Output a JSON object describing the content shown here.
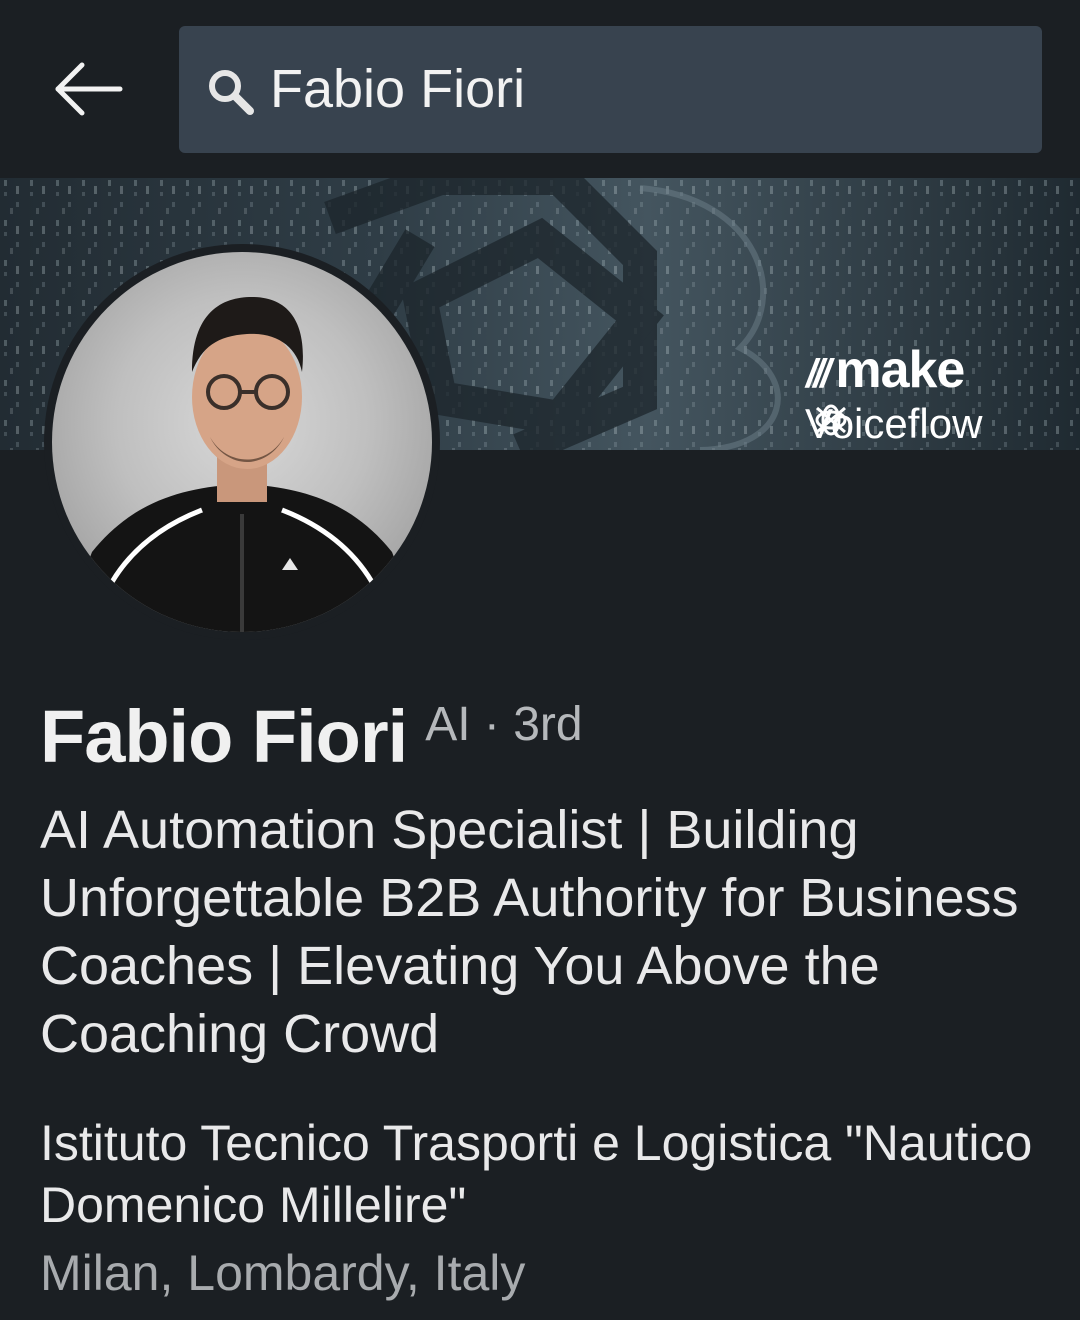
{
  "search": {
    "query": "Fabio Fiori"
  },
  "banner": {
    "brand_make": "make",
    "brand_voiceflow": "Voiceflow"
  },
  "profile": {
    "name": "Fabio Fiori",
    "meta": "AI · 3rd",
    "headline": "AI Automation Specialist | Building Unforgettable B2B Authority for Business Coaches | Elevating You Above the Coaching Crowd",
    "education": "Istituto Tecnico Trasporti e Logistica \"Nautico Domenico Millelire\"",
    "location": "Milan, Lombardy, Italy"
  },
  "icons": {
    "back": "arrow-left-icon",
    "search": "search-icon"
  },
  "colors": {
    "background": "#1b1f23",
    "search_field": "#38434f",
    "primary_text": "#e9e9ea",
    "secondary_text": "#a8abae"
  }
}
